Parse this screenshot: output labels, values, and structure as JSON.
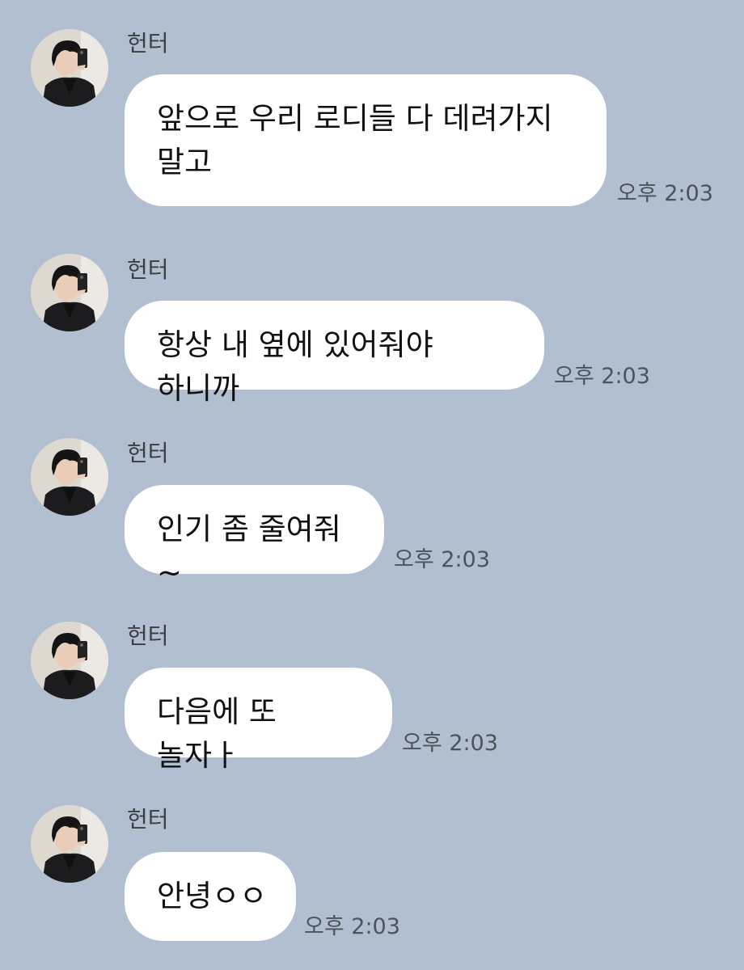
{
  "chat": {
    "messages": [
      {
        "sender": "헌터",
        "text": "앞으로 우리 로디들 다 데려가지 말고",
        "time": "오후 2:03"
      },
      {
        "sender": "헌터",
        "text": "항상 내 옆에 있어줘야 하니까",
        "time": "오후 2:03"
      },
      {
        "sender": "헌터",
        "text": "인기 좀 줄여줘~",
        "time": "오후 2:03"
      },
      {
        "sender": "헌터",
        "text": "다음에 또 놀자ㅏ",
        "time": "오후 2:03"
      },
      {
        "sender": "헌터",
        "text": "안녕ㅇㅇ",
        "time": "오후 2:03"
      }
    ]
  },
  "colors": {
    "background": "#b1bfd1",
    "bubble": "#ffffff",
    "time_text": "#4d535b"
  },
  "icons": {
    "avatar": "profile-photo-avatar"
  }
}
